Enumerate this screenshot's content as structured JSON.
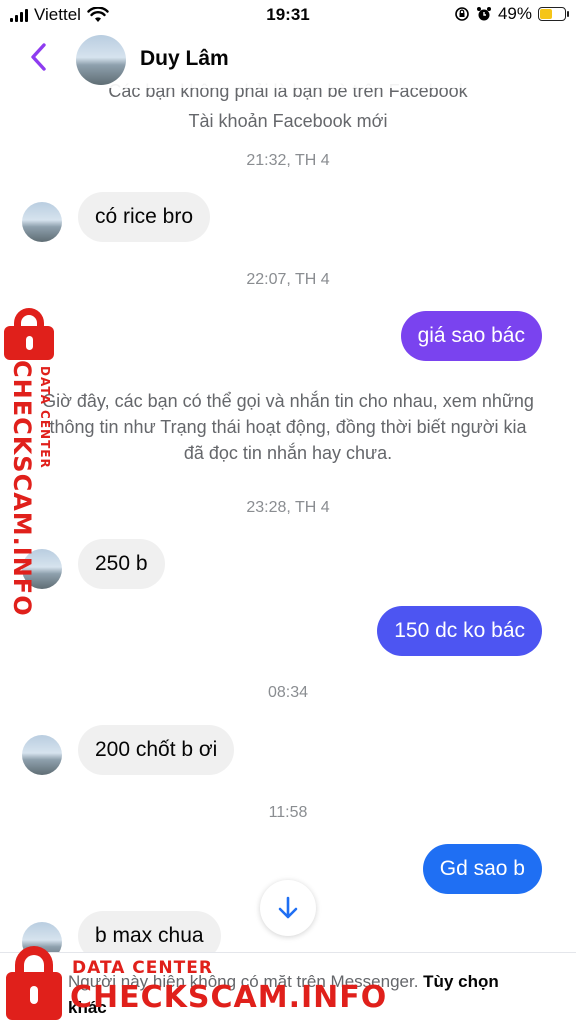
{
  "status_bar": {
    "carrier": "Viettel",
    "time": "19:31",
    "battery": "49%",
    "battery_level": 0.49,
    "icons": [
      "signal-icon",
      "wifi-icon",
      "orientation-lock-icon",
      "alarm-icon",
      "battery-icon"
    ]
  },
  "header": {
    "contact_name": "Duy Lâm",
    "back_icon": "chevron-left-icon"
  },
  "colors": {
    "accent": "#8e3cf0",
    "sent_purple": "#7a43ef",
    "sent_indigo": "#4d55f2",
    "sent_blue": "#1f6ff3",
    "received_bg": "#f0f0f0",
    "watermark_red": "#e0201b"
  },
  "chat": {
    "system_top_line1": "Các bạn không phải là bạn bè trên Facebook",
    "system_top_line2": "Tài khoản Facebook mới",
    "ts1": "21:32, TH 4",
    "msg1": "có rice bro",
    "ts2": "22:07, TH 4",
    "msg2": "giá sao bác",
    "system_mid_line1": "Giờ đây, các bạn có thể gọi và nhắn tin cho nhau, xem những",
    "system_mid_line2": "thông tin như Trạng thái hoạt động, đồng thời biết người kia",
    "system_mid_line3": "đã đọc tin nhắn hay chưa.",
    "ts3": "23:28, TH 4",
    "msg3": "250 b",
    "msg4": "150 dc ko bác",
    "ts4": "08:34",
    "msg5": "200 chốt b ơi",
    "ts5": "11:58",
    "msg6": "Gd sao b",
    "msg7": "b max chua"
  },
  "scroll_button": {
    "icon": "arrow-down-icon"
  },
  "footer": {
    "notice": "Người này hiện không có mặt trên Messenger.",
    "action": "Tùy chọn khác"
  },
  "watermark": {
    "small": "DATA CENTER",
    "big": "CHECKSCAM.INFO"
  }
}
